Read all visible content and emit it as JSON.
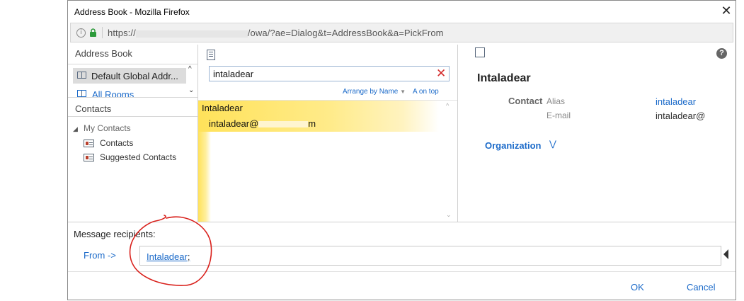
{
  "window": {
    "title": "Address Book - Mozilla Firefox",
    "close_glyph": "✕",
    "url_prefix": "https://",
    "url_suffix": "/owa/?ae=Dialog&t=AddressBook&a=PickFrom"
  },
  "left_panel": {
    "header": "Address Book",
    "books": [
      {
        "label": "Default Global Addr...",
        "selected": true
      },
      {
        "label": "All Rooms",
        "selected": false
      }
    ],
    "contacts_header": "Contacts",
    "my_contacts": "My Contacts",
    "folders": [
      "Contacts",
      "Suggested Contacts"
    ]
  },
  "middle_panel": {
    "search_value": "intaladear",
    "arrange_by": "Arrange by Name",
    "sort_order": "A on top",
    "results": [
      {
        "name": "Intaladear",
        "email_start": "intaladear@",
        "email_end": "m"
      }
    ]
  },
  "detail": {
    "name": "Intaladear",
    "section": "Contact",
    "fields": [
      {
        "label": "Alias",
        "value": "intaladear"
      },
      {
        "label": "E-mail",
        "value": "intaladear@"
      }
    ],
    "organization": "Organization",
    "help": "?"
  },
  "bottom": {
    "message_recipients": "Message recipients:",
    "from_label": "From ->",
    "recipient": "Intaladear",
    "recipient_sep": ";",
    "ok": "OK",
    "cancel": "Cancel"
  },
  "colors": {
    "link": "#1b6ac9",
    "highlight": "#ffe25a",
    "annotation": "#d9211c"
  },
  "icons": [
    "info-icon",
    "lock-icon",
    "book-icon",
    "contacts-icon",
    "notebook-icon",
    "clear-search-icon",
    "help-icon",
    "detail-card-icon",
    "chevron-down-icon",
    "collapse-triangle-icon"
  ]
}
